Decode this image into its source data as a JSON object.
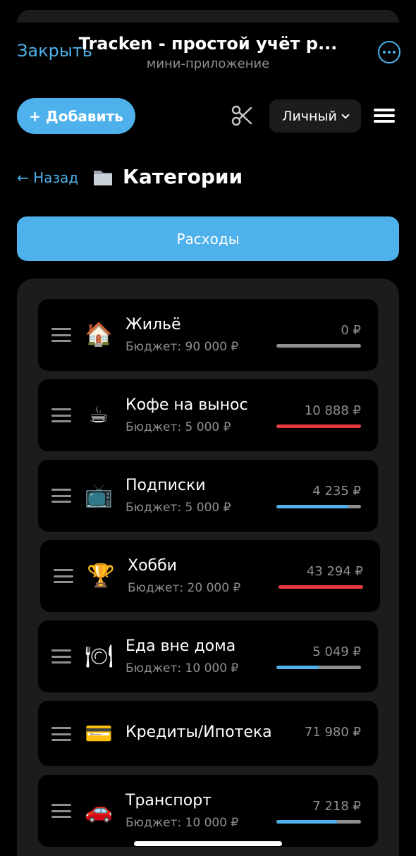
{
  "header": {
    "close_label": "Закрыть",
    "title": "Tracken - простой учёт р...",
    "subtitle": "мини-приложение",
    "more_icon": "ellipsis-circle-icon"
  },
  "toolbar": {
    "add_label": "+ Добавить",
    "scissors_icon": "scissors-icon",
    "account_selected": "Личный",
    "menu_icon": "hamburger-icon"
  },
  "nav": {
    "back_label": "← Назад",
    "page_icon": "folder-icon",
    "page_title": "Категории"
  },
  "tab": {
    "label": "Расходы"
  },
  "colors": {
    "accent": "#4eb1ec",
    "over_budget": "#e8373f",
    "track": "#8e8e93",
    "card": "#000000",
    "panel": "#1c1c1e"
  },
  "categories": [
    {
      "emoji": "🏠",
      "icon": "house-icon",
      "name": "Жильё",
      "budget": "Бюджет: 90 000 ₽",
      "amount": "0 ₽",
      "progress": 0,
      "status": "under"
    },
    {
      "emoji": "☕",
      "icon": "coffee-icon",
      "name": "Кофе на вынос",
      "budget": "Бюджет: 5 000 ₽",
      "amount": "10 888 ₽",
      "progress": 1,
      "status": "over"
    },
    {
      "emoji": "📺",
      "icon": "tv-icon",
      "name": "Подписки",
      "budget": "Бюджет: 5 000 ₽",
      "amount": "4 235 ₽",
      "progress": 0.85,
      "status": "under"
    },
    {
      "emoji": "🏆",
      "icon": "trophy-icon",
      "name": "Хобби",
      "budget": "Бюджет: 20 000 ₽",
      "amount": "43 294 ₽",
      "progress": 1,
      "status": "over"
    },
    {
      "emoji": "🍽",
      "icon": "plate-icon",
      "name": "Еда вне дома",
      "budget": "Бюджет: 10 000 ₽",
      "amount": "5 049 ₽",
      "progress": 0.5,
      "status": "under"
    },
    {
      "emoji": "💳",
      "icon": "credit-card-icon",
      "name": "Кредиты/Ипотека",
      "budget": "",
      "amount": "71 980 ₽",
      "progress": null,
      "status": "none"
    },
    {
      "emoji": "🚗",
      "icon": "car-icon",
      "name": "Транспорт",
      "budget": "Бюджет: 10 000 ₽",
      "amount": "7 218 ₽",
      "progress": 0.72,
      "status": "under"
    }
  ]
}
